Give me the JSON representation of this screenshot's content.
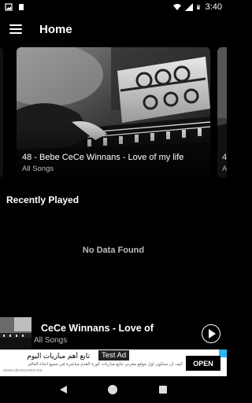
{
  "status_bar": {
    "time": "3:40"
  },
  "header": {
    "title": "Home"
  },
  "carousel": {
    "cards": [
      {
        "title": "48 - Bebe  CeCe Winnans - Love of my life",
        "subtitle": "All Songs"
      }
    ],
    "peek_right": {
      "title": "4",
      "subtitle": "A"
    }
  },
  "recent": {
    "title": "Recently Played",
    "empty_text": "No Data Found"
  },
  "now_playing": {
    "title": "CeCe Winnans - Love of",
    "subtitle": "All Songs"
  },
  "ad": {
    "tag": "Test Ad",
    "headline": "تابع أهم مباريات اليوم",
    "body": "كيف ان ستكون اول موقع مغربي نتابع مباريات كورة القدم مباشرة في جميع انحاء العالم",
    "url": "www.clicnscores.ma",
    "cta": "OPEN",
    "close_color": "#29b6f6"
  }
}
